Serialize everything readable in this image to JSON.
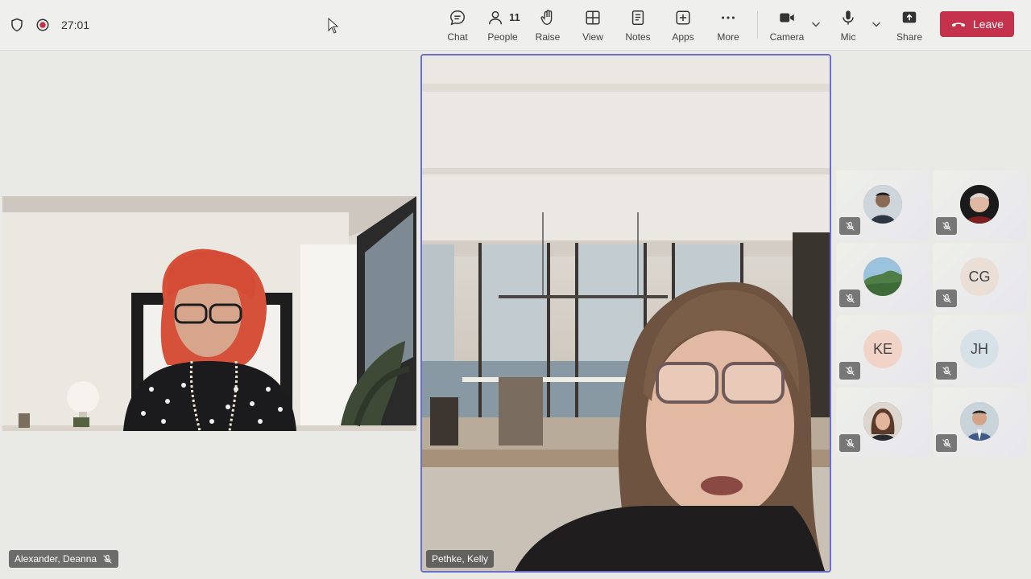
{
  "meeting": {
    "timer": "27:01"
  },
  "toolbar": {
    "chat_label": "Chat",
    "people_label": "People",
    "people_count": "11",
    "raise_label": "Raise",
    "view_label": "View",
    "notes_label": "Notes",
    "apps_label": "Apps",
    "more_label": "More",
    "camera_label": "Camera",
    "mic_label": "Mic",
    "share_label": "Share",
    "leave_label": "Leave"
  },
  "colors": {
    "leave": "#c4314b",
    "active_speaker_border": "#6b6fc9",
    "recording": "#c4314b"
  },
  "videos": {
    "left": {
      "name": "Alexander, Deanna"
    },
    "center": {
      "name": "Pethke, Kelly"
    }
  },
  "participants": [
    {
      "initials": "",
      "avatar_color": "#5b6f86"
    },
    {
      "initials": "",
      "avatar_color": "#2f2f33"
    },
    {
      "initials": "",
      "avatar_color": "#6d9a63"
    },
    {
      "initials": "CG",
      "avatar_color": "#eadfd6"
    },
    {
      "initials": "KE",
      "avatar_color": "#f2d3c8"
    },
    {
      "initials": "JH",
      "avatar_color": "#d6e2e8"
    },
    {
      "initials": "",
      "avatar_color": "#7b5a4a"
    },
    {
      "initials": "",
      "avatar_color": "#8da0b5"
    }
  ]
}
